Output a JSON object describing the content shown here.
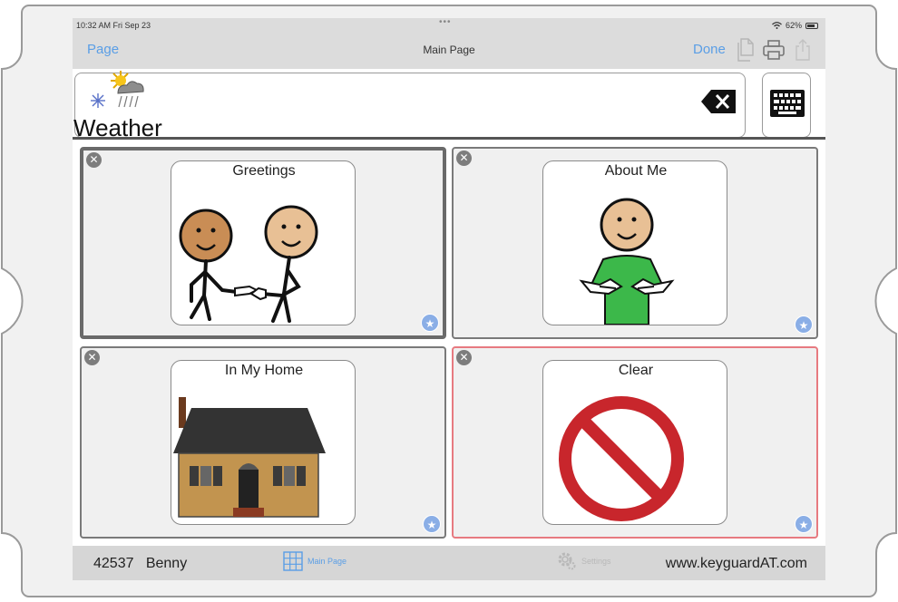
{
  "status": {
    "time": "10:32 AM  Fri Sep 23",
    "battery": "62%"
  },
  "nav": {
    "left": "Page",
    "title": "Main Page",
    "done": "Done"
  },
  "message": {
    "word": "Weather"
  },
  "cells": [
    {
      "label": "Greetings",
      "state": "selected"
    },
    {
      "label": "About Me",
      "state": "normal"
    },
    {
      "label": "In My Home",
      "state": "normal"
    },
    {
      "label": "Clear",
      "state": "alert"
    }
  ],
  "bottom": {
    "device": "42537   Benny",
    "tab_main": "Main Page",
    "tab_settings": "Settings",
    "url": "www.keyguardAT.com"
  },
  "colors": {
    "accent": "#5a9ee6",
    "alert_border": "#e77a80",
    "no_symbol": "#c8262c"
  }
}
